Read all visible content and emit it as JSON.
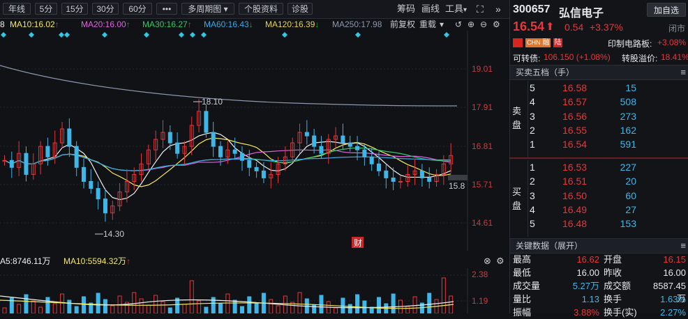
{
  "toolbar": {
    "periods": [
      "年线",
      "5分",
      "15分",
      "30分",
      "60分"
    ],
    "more": "•••",
    "multi_period": "多周期图",
    "stock_info": "个股资料",
    "diagnose": "诊股",
    "chips": "筹码",
    "draw": "画线",
    "tools": "工具"
  },
  "ma_line": {
    "ma5_tail": "8",
    "ma10": "MA10:16.02",
    "ma20": "MA20:16.00",
    "ma30": "MA30:16.27",
    "ma60": "MA60:16.43",
    "ma120": "MA120:16.39",
    "ma250": "MA250:17.98",
    "adjust": "前复权",
    "overlay": "重载",
    "arrows": [
      "↑",
      "↑",
      "↑",
      "↓",
      "↓"
    ]
  },
  "chart": {
    "y_labels": [
      "19.01",
      "17.91",
      "16.81",
      "15.71",
      "14.61"
    ],
    "high_label": "18.10",
    "low_label": "14.30",
    "last_label": "15.8",
    "finance_badge": "财"
  },
  "volume": {
    "ma5": "A5:8746.11万",
    "ma10": "MA10:5594.32万",
    "y_labels": [
      "2.38",
      "1.19"
    ]
  },
  "quote": {
    "code": "300657",
    "name": "弘信电子",
    "add_button": "加自选",
    "price": "16.54",
    "change": "0.54",
    "change_pct": "+3.37%",
    "status": "闭市",
    "tags": [
      "CHN",
      "融",
      "陆"
    ],
    "sector": "印制电路板:",
    "sector_pct": "+3.08%",
    "convertible_label": "可转债:",
    "convertible_value": "106.150 (+1.08%)",
    "premium_label": "转股溢价:",
    "premium_value": "18.41%"
  },
  "orderbook": {
    "title": "买卖五档（手）",
    "sell_label": [
      "卖",
      "盘"
    ],
    "buy_label": [
      "买",
      "盘"
    ],
    "asks": [
      {
        "level": "5",
        "price": "16.58",
        "vol": "15"
      },
      {
        "level": "4",
        "price": "16.57",
        "vol": "508"
      },
      {
        "level": "3",
        "price": "16.56",
        "vol": "273"
      },
      {
        "level": "2",
        "price": "16.55",
        "vol": "162"
      },
      {
        "level": "1",
        "price": "16.54",
        "vol": "591"
      }
    ],
    "bids": [
      {
        "level": "1",
        "price": "16.53",
        "vol": "227"
      },
      {
        "level": "2",
        "price": "16.51",
        "vol": "20"
      },
      {
        "level": "3",
        "price": "16.50",
        "vol": "60"
      },
      {
        "level": "4",
        "price": "16.49",
        "vol": "27"
      },
      {
        "level": "5",
        "price": "16.48",
        "vol": "153"
      }
    ]
  },
  "keydata": {
    "title": "关键数据（展开）",
    "rows": [
      {
        "k1": "最高",
        "v1": "16.62",
        "k2": "开盘",
        "v2": "16.15"
      },
      {
        "k1": "最低",
        "v1": "16.00",
        "k2": "昨收",
        "v2": "16.00"
      },
      {
        "k1": "成交量",
        "v1": "5.27万",
        "k2": "成交额",
        "v2": "8587.45万"
      },
      {
        "k1": "量比",
        "v1": "1.13",
        "k2": "换手",
        "v2": "1.63%"
      },
      {
        "k1": "振幅",
        "v1": "3.88%",
        "k2": "换手(实)",
        "v2": "2.27%"
      }
    ]
  },
  "colors": {
    "up": "#e8363a",
    "down": "#3fb6e8",
    "bg": "#101216"
  }
}
